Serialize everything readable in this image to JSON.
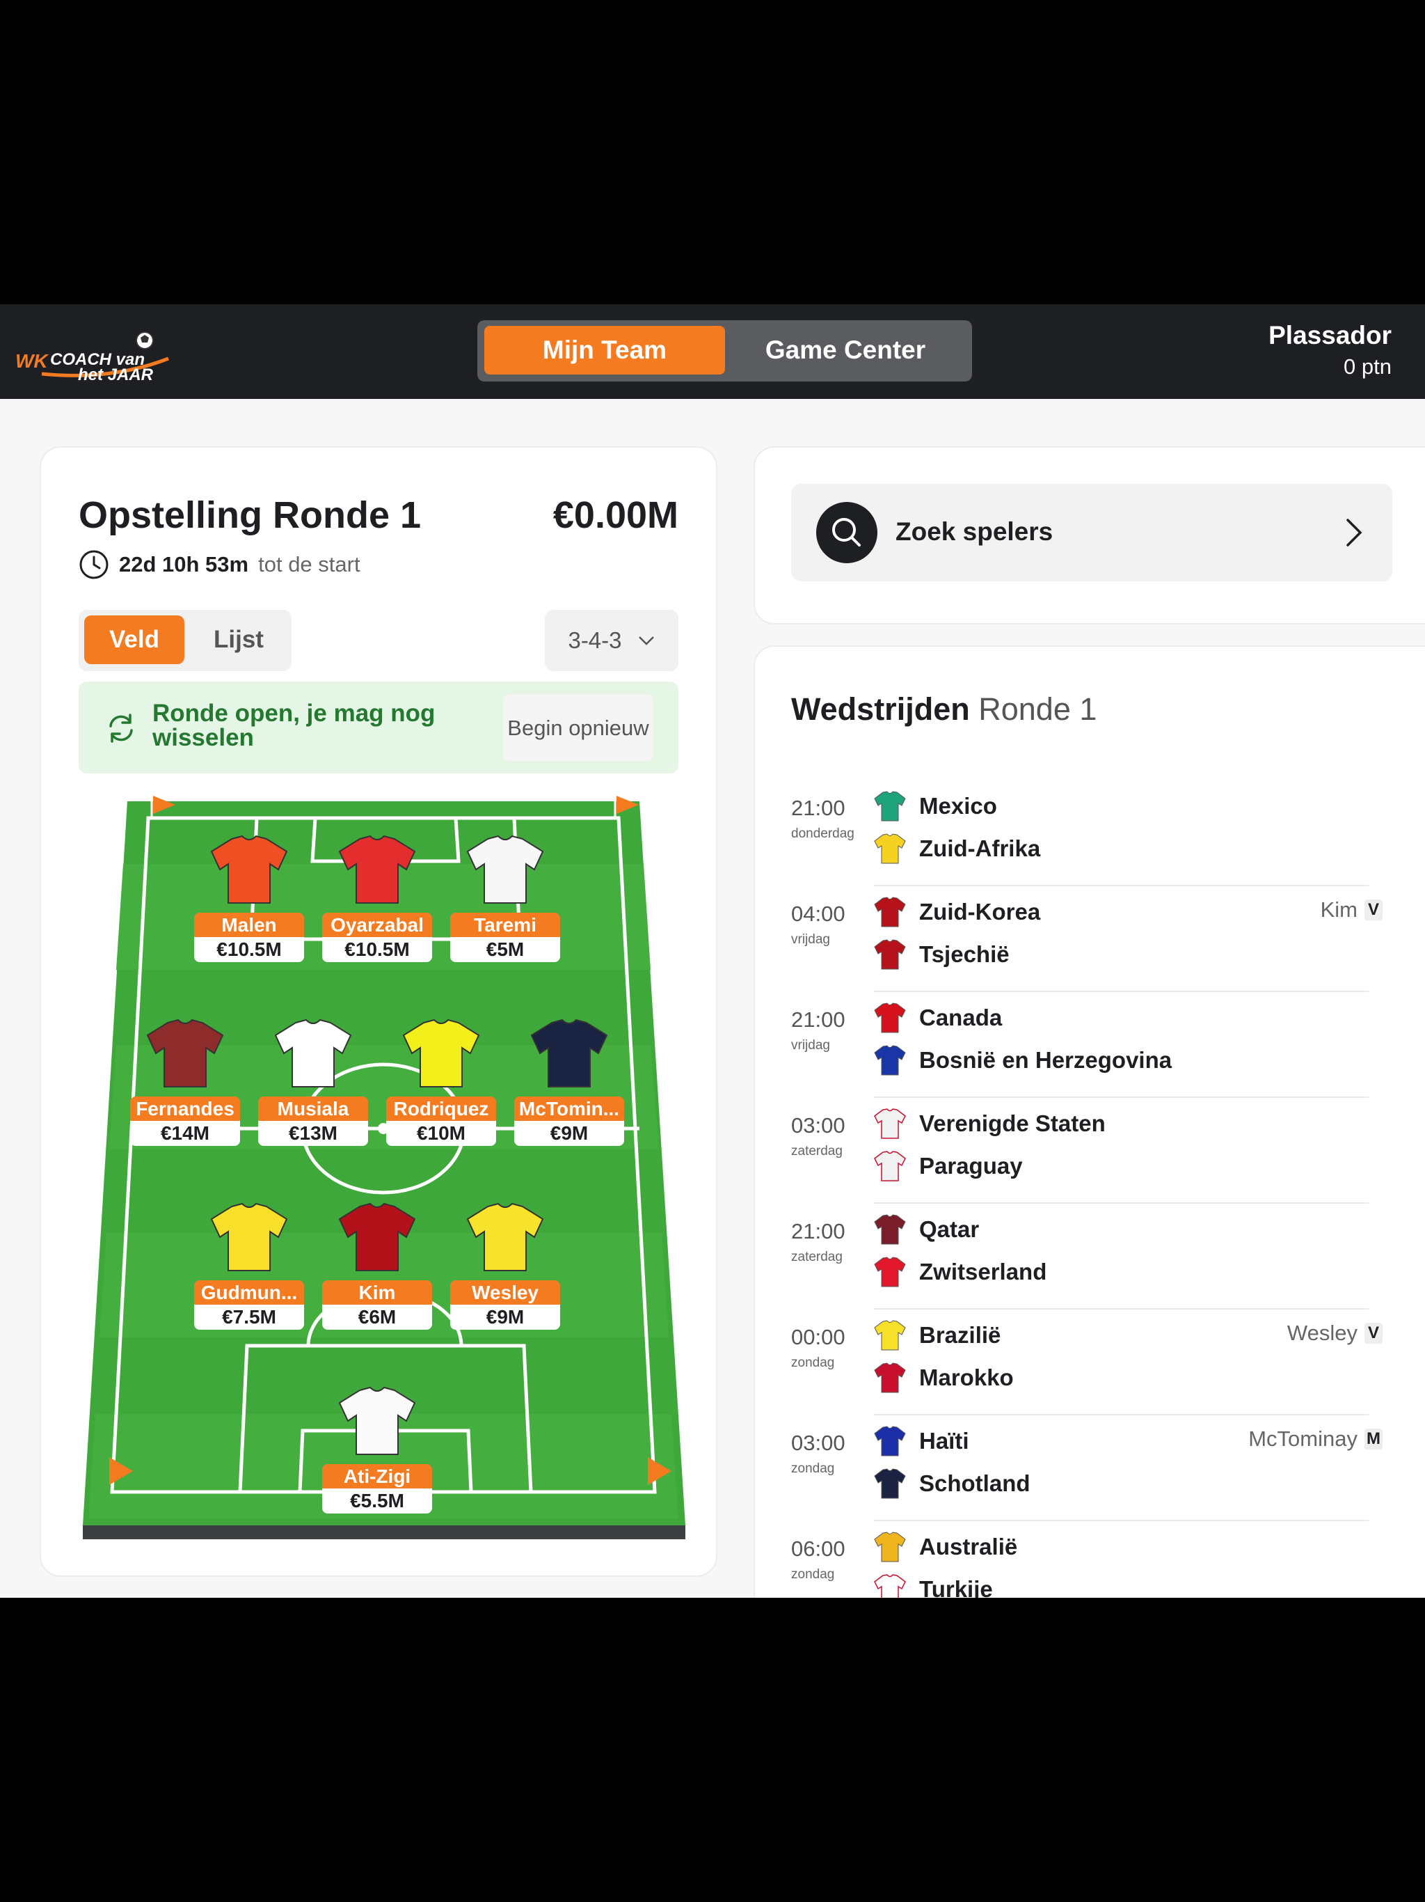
{
  "header": {
    "logo_text": {
      "wk": "WK",
      "coach": "COACH van",
      "jaar": "het JAAR"
    },
    "tabs": [
      {
        "label": "Mijn Team",
        "active": true
      },
      {
        "label": "Game Center",
        "active": false
      }
    ],
    "user": {
      "name": "Plassador",
      "points": "0 ptn"
    }
  },
  "lineup": {
    "title": "Opstelling Ronde 1",
    "budget": "€0.00M",
    "countdown": {
      "value": "22d 10h 53m",
      "suffix": "tot de start"
    },
    "view_toggle": {
      "veld": "Veld",
      "lijst": "Lijst",
      "selected": "Veld"
    },
    "formation": "3-4-3",
    "banner": {
      "message": "Ronde open, je mag nog wisselen",
      "button": "Begin opnieuw"
    },
    "players": [
      {
        "name": "Malen",
        "price": "€10.5M",
        "shirt": "#f04e23",
        "accent": "#f04e23"
      },
      {
        "name": "Oyarzabal",
        "price": "€10.5M",
        "shirt": "#e42e2e",
        "accent": "#1b2b63"
      },
      {
        "name": "Taremi",
        "price": "€5M",
        "shirt": "#f7f7f7",
        "accent": "#1f8f3a"
      },
      {
        "name": "Fernandes",
        "price": "€14M",
        "shirt": "#8e2b2b",
        "accent": "#8e2b2b"
      },
      {
        "name": "Musiala",
        "price": "€13M",
        "shirt": "#ffffff",
        "accent": "#e8a11a"
      },
      {
        "name": "Rodriquez",
        "price": "€10M",
        "shirt": "#f3ef1a",
        "accent": "#111111"
      },
      {
        "name": "McTomin...",
        "price": "€9M",
        "shirt": "#1a2442",
        "accent": "#ffffff"
      },
      {
        "name": "Gudmun...",
        "price": "€7.5M",
        "shirt": "#f8df2a",
        "accent": "#2a4fb0"
      },
      {
        "name": "Kim",
        "price": "€6M",
        "shirt": "#b3121a",
        "accent": "#b3121a"
      },
      {
        "name": "Wesley",
        "price": "€9M",
        "shirt": "#f7e22c",
        "accent": "#1f8f3a"
      },
      {
        "name": "Ati-Zigi",
        "price": "€5.5M",
        "shirt": "#fafafa",
        "accent": "#cfa44a"
      }
    ]
  },
  "search": {
    "label": "Zoek spelers"
  },
  "matches": {
    "title": "Wedstrijden",
    "subtitle": "Ronde 1",
    "list": [
      {
        "time": "21:00",
        "day": "donderdag",
        "home": "Mexico",
        "away": "Zuid-Afrika",
        "home_color": "#1ea37a",
        "away_color": "#f4d21f",
        "pick": "",
        "pick_badge": ""
      },
      {
        "time": "04:00",
        "day": "vrijdag",
        "home": "Zuid-Korea",
        "away": "Tsjechië",
        "home_color": "#b5121b",
        "away_color": "#b5121b",
        "pick": "Kim",
        "pick_badge": "V"
      },
      {
        "time": "21:00",
        "day": "vrijdag",
        "home": "Canada",
        "away": "Bosnië en Herzegovina",
        "home_color": "#d4111c",
        "away_color": "#1a35a8",
        "pick": "",
        "pick_badge": ""
      },
      {
        "time": "03:00",
        "day": "zaterdag",
        "home": "Verenigde Staten",
        "away": "Paraguay",
        "home_color": "#f2f2f2",
        "away_color": "#f2f2f2",
        "pick": "",
        "pick_badge": ""
      },
      {
        "time": "21:00",
        "day": "zaterdag",
        "home": "Qatar",
        "away": "Zwitserland",
        "home_color": "#7a1d2a",
        "away_color": "#e3172c",
        "pick": "",
        "pick_badge": ""
      },
      {
        "time": "00:00",
        "day": "zondag",
        "home": "Brazilië",
        "away": "Marokko",
        "home_color": "#f6e02a",
        "away_color": "#c8102e",
        "pick": "Wesley",
        "pick_badge": "V"
      },
      {
        "time": "03:00",
        "day": "zondag",
        "home": "Haïti",
        "away": "Schotland",
        "home_color": "#1d2fa8",
        "away_color": "#1a2442",
        "pick": "McTominay",
        "pick_badge": "M"
      },
      {
        "time": "06:00",
        "day": "zondag",
        "home": "Australië",
        "away": "Turkije",
        "home_color": "#f0b41c",
        "away_color": "#ffffff",
        "pick": "",
        "pick_badge": ""
      }
    ]
  }
}
